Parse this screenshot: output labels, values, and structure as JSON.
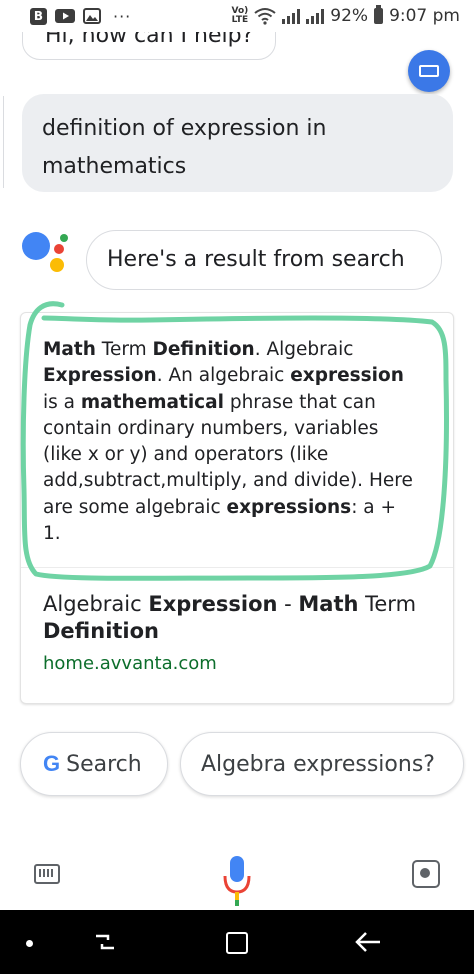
{
  "status_bar": {
    "left_badge": "B",
    "overflow": "···",
    "lte_top": "Vo)",
    "lte_bottom": "LTE",
    "battery_percent": "92%",
    "time": "9:07 pm"
  },
  "conversation": {
    "assistant_greeting": "Hi, how can I help?",
    "user_query": "definition of expression in mathematics",
    "assistant_reply": "Here's a result from search"
  },
  "result": {
    "snippet_parts": [
      {
        "t": "Math",
        "b": true
      },
      {
        "t": " Term ",
        "b": false
      },
      {
        "t": "Definition",
        "b": true
      },
      {
        "t": ". Algebraic ",
        "b": false
      },
      {
        "t": "Expression",
        "b": true
      },
      {
        "t": ". An algebraic ",
        "b": false
      },
      {
        "t": "expression",
        "b": true
      },
      {
        "t": " is a ",
        "b": false
      },
      {
        "t": "mathematical",
        "b": true
      },
      {
        "t": " phrase that can contain ordinary numbers, variables (like x or y) and operators (like add,subtract,multiply, and divide). Here are some algebraic ",
        "b": false
      },
      {
        "t": "expressions",
        "b": true
      },
      {
        "t": ": a + 1.",
        "b": false
      }
    ],
    "title_parts": [
      {
        "t": "Algebraic ",
        "b": false
      },
      {
        "t": "Expression",
        "b": true
      },
      {
        "t": " - ",
        "b": false
      },
      {
        "t": "Math",
        "b": true
      },
      {
        "t": " Term ",
        "b": false
      },
      {
        "t": "Definition",
        "b": true
      }
    ],
    "url": "home.avvanta.com"
  },
  "suggestions": {
    "search_label": "Search",
    "google_mark": "G",
    "algebra_label": "Algebra expressions?"
  },
  "colors": {
    "accent_blue": "#4285f4",
    "highlight_green": "#6fd3a4",
    "url_green": "#0d6e2c"
  },
  "icons": {
    "keyboard": "keyboard-icon",
    "mic": "microphone-icon",
    "lens": "lens-icon"
  }
}
